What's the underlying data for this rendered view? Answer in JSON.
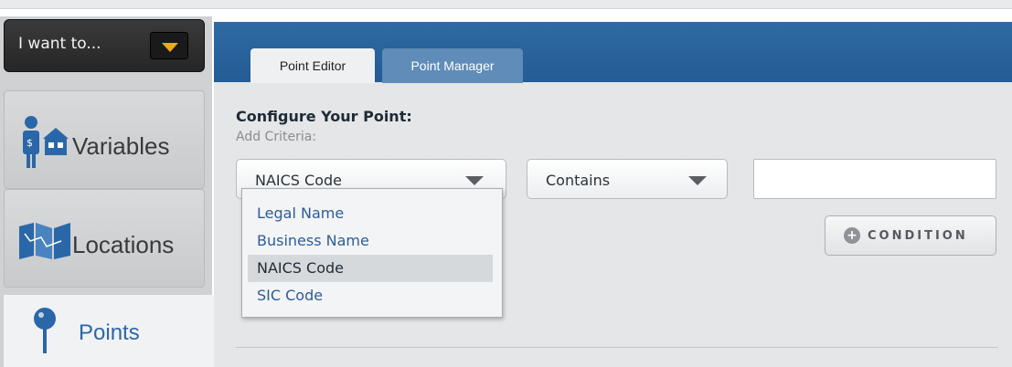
{
  "sidebar": {
    "i_want_label": "I want to...",
    "items": [
      {
        "label": "Variables",
        "icon": "person-building-icon",
        "active": false
      },
      {
        "label": "Locations",
        "icon": "map-icon",
        "active": false
      },
      {
        "label": "Points",
        "icon": "map-pin-icon",
        "active": true
      }
    ]
  },
  "tabs": [
    {
      "label": "Point Editor",
      "active": true
    },
    {
      "label": "Point Manager",
      "active": false
    }
  ],
  "configure": {
    "title": "Configure Your Point:",
    "subtitle": "Add Criteria:"
  },
  "criteria": {
    "field_value": "NAICS Code",
    "operator_value": "Contains",
    "text_value": "",
    "condition_button": "CONDITION"
  },
  "dropdown": {
    "options": [
      "Legal Name",
      "Business Name",
      "NAICS Code",
      "SIC Code"
    ],
    "selected": "NAICS Code"
  },
  "colors": {
    "header_blue": "#2f6aa3",
    "accent_orange": "#f5a51b",
    "link_blue": "#2c5d96"
  }
}
